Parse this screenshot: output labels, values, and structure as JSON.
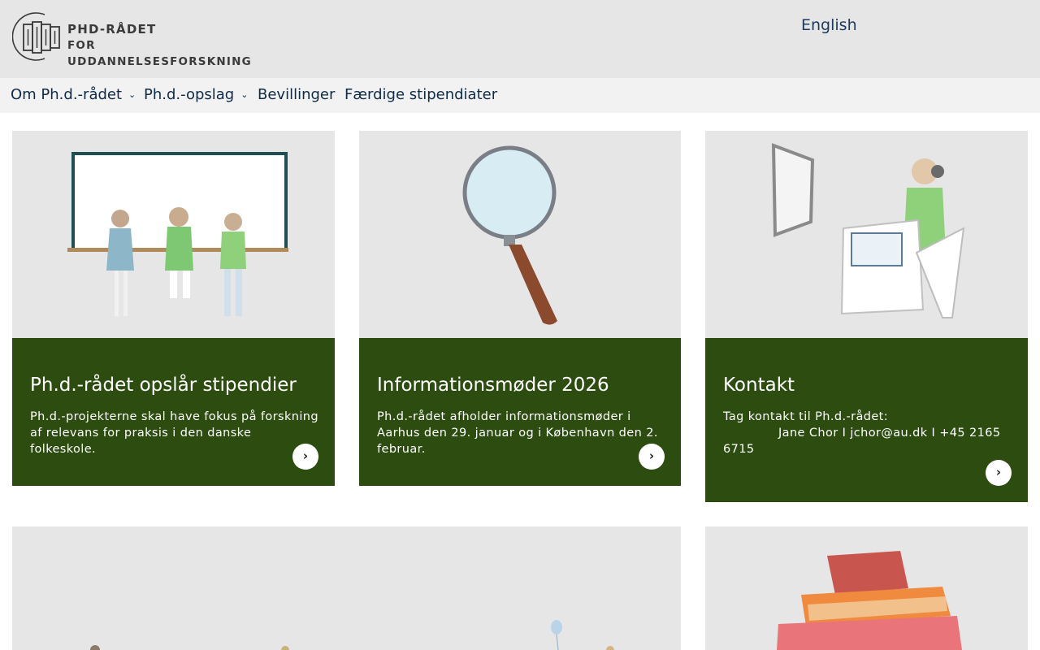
{
  "header": {
    "logo_line1": "PHD-RÅDET",
    "logo_line2": "FOR UDDANNELSESFORSKNING",
    "language_link": "English"
  },
  "nav": {
    "items": [
      {
        "label": "Om Ph.d.-rådet",
        "has_dropdown": true
      },
      {
        "label": "Ph.d.-opslag",
        "has_dropdown": true
      },
      {
        "label": "Bevillinger",
        "has_dropdown": false
      },
      {
        "label": "Færdige stipendiater",
        "has_dropdown": false
      }
    ]
  },
  "cards": [
    {
      "title": "Ph.d.-rådet opslår stipendier",
      "description": "Ph.d.-projekterne skal have fokus på forskning af relevans for praksis i den danske folkeskole.",
      "image_icon": "children-at-whiteboard-illustration"
    },
    {
      "title": "Informationsmøder 2026",
      "description": "Ph.d.-rådet afholder informationsmøder i Aarhus den 29. januar og i København den 2. februar.",
      "image_icon": "magnifying-glass-illustration"
    },
    {
      "title": "Kontakt",
      "description_line1": "Tag kontakt til Ph.d.-rådet:",
      "description_line2": "Jane Chor  I  jchor@au.dk  I  +45 2165 6715",
      "image_icon": "child-at-desk-illustration"
    }
  ],
  "colors": {
    "header_bg": "#e6e6e6",
    "nav_bg": "#f2f2f2",
    "card_green": "#2c4c10",
    "link_blue": "#1c3a5e"
  }
}
